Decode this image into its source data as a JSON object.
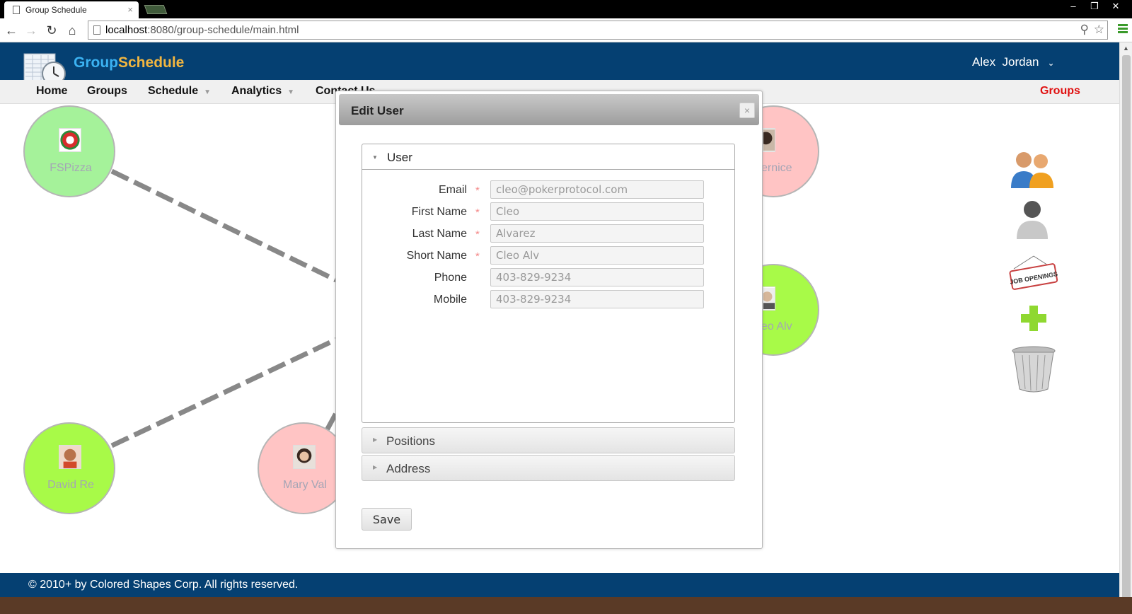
{
  "browser": {
    "tab_title": "Group Schedule",
    "tab_close": "×",
    "url_host": "localhost",
    "url_rest": ":8080/group-schedule/main.html",
    "window_buttons": [
      "–",
      "❐",
      "✕"
    ]
  },
  "header": {
    "brand_part1": "Group",
    "brand_part2": "Schedule",
    "user_name": "Alex  Jordan",
    "brand_color_1": "#3bb2f2",
    "brand_color_2": "#f2b640",
    "header_bg": "#054072"
  },
  "menu": {
    "items": [
      "Home",
      "Groups",
      "Schedule",
      "Analytics",
      "Contact Us"
    ],
    "right_link": "Groups"
  },
  "nodes": [
    {
      "label": "FSPizza",
      "color": "#a5f29a"
    },
    {
      "label": "ernice",
      "color": "#ffc4c4"
    },
    {
      "label": "eo Alv",
      "color": "#a8fa48"
    },
    {
      "label": "David Re",
      "color": "#a8fa48"
    },
    {
      "label": "Mary Val",
      "color": "#ffc4c4"
    }
  ],
  "side_icons": [
    "groups-icon",
    "user-icon",
    "job-openings-icon",
    "add-icon",
    "trash-icon"
  ],
  "side_sign_text": "JOB OPENINGS",
  "modal": {
    "title": "Edit User",
    "close": "×",
    "sections": {
      "user": "User",
      "positions": "Positions",
      "address": "Address"
    },
    "fields": [
      {
        "label": "Email",
        "required": true,
        "value": "cleo@pokerprotocol.com"
      },
      {
        "label": "First Name",
        "required": true,
        "value": "Cleo"
      },
      {
        "label": "Last Name",
        "required": true,
        "value": "Alvarez"
      },
      {
        "label": "Short Name",
        "required": true,
        "value": "Cleo Alv"
      },
      {
        "label": "Phone",
        "required": false,
        "value": "403-829-9234"
      },
      {
        "label": "Mobile",
        "required": false,
        "value": "403-829-9234"
      }
    ],
    "required_mark": "*",
    "save_label": "Save"
  },
  "footer": {
    "text": "© 2010+ by Colored Shapes Corp. All rights reserved."
  }
}
